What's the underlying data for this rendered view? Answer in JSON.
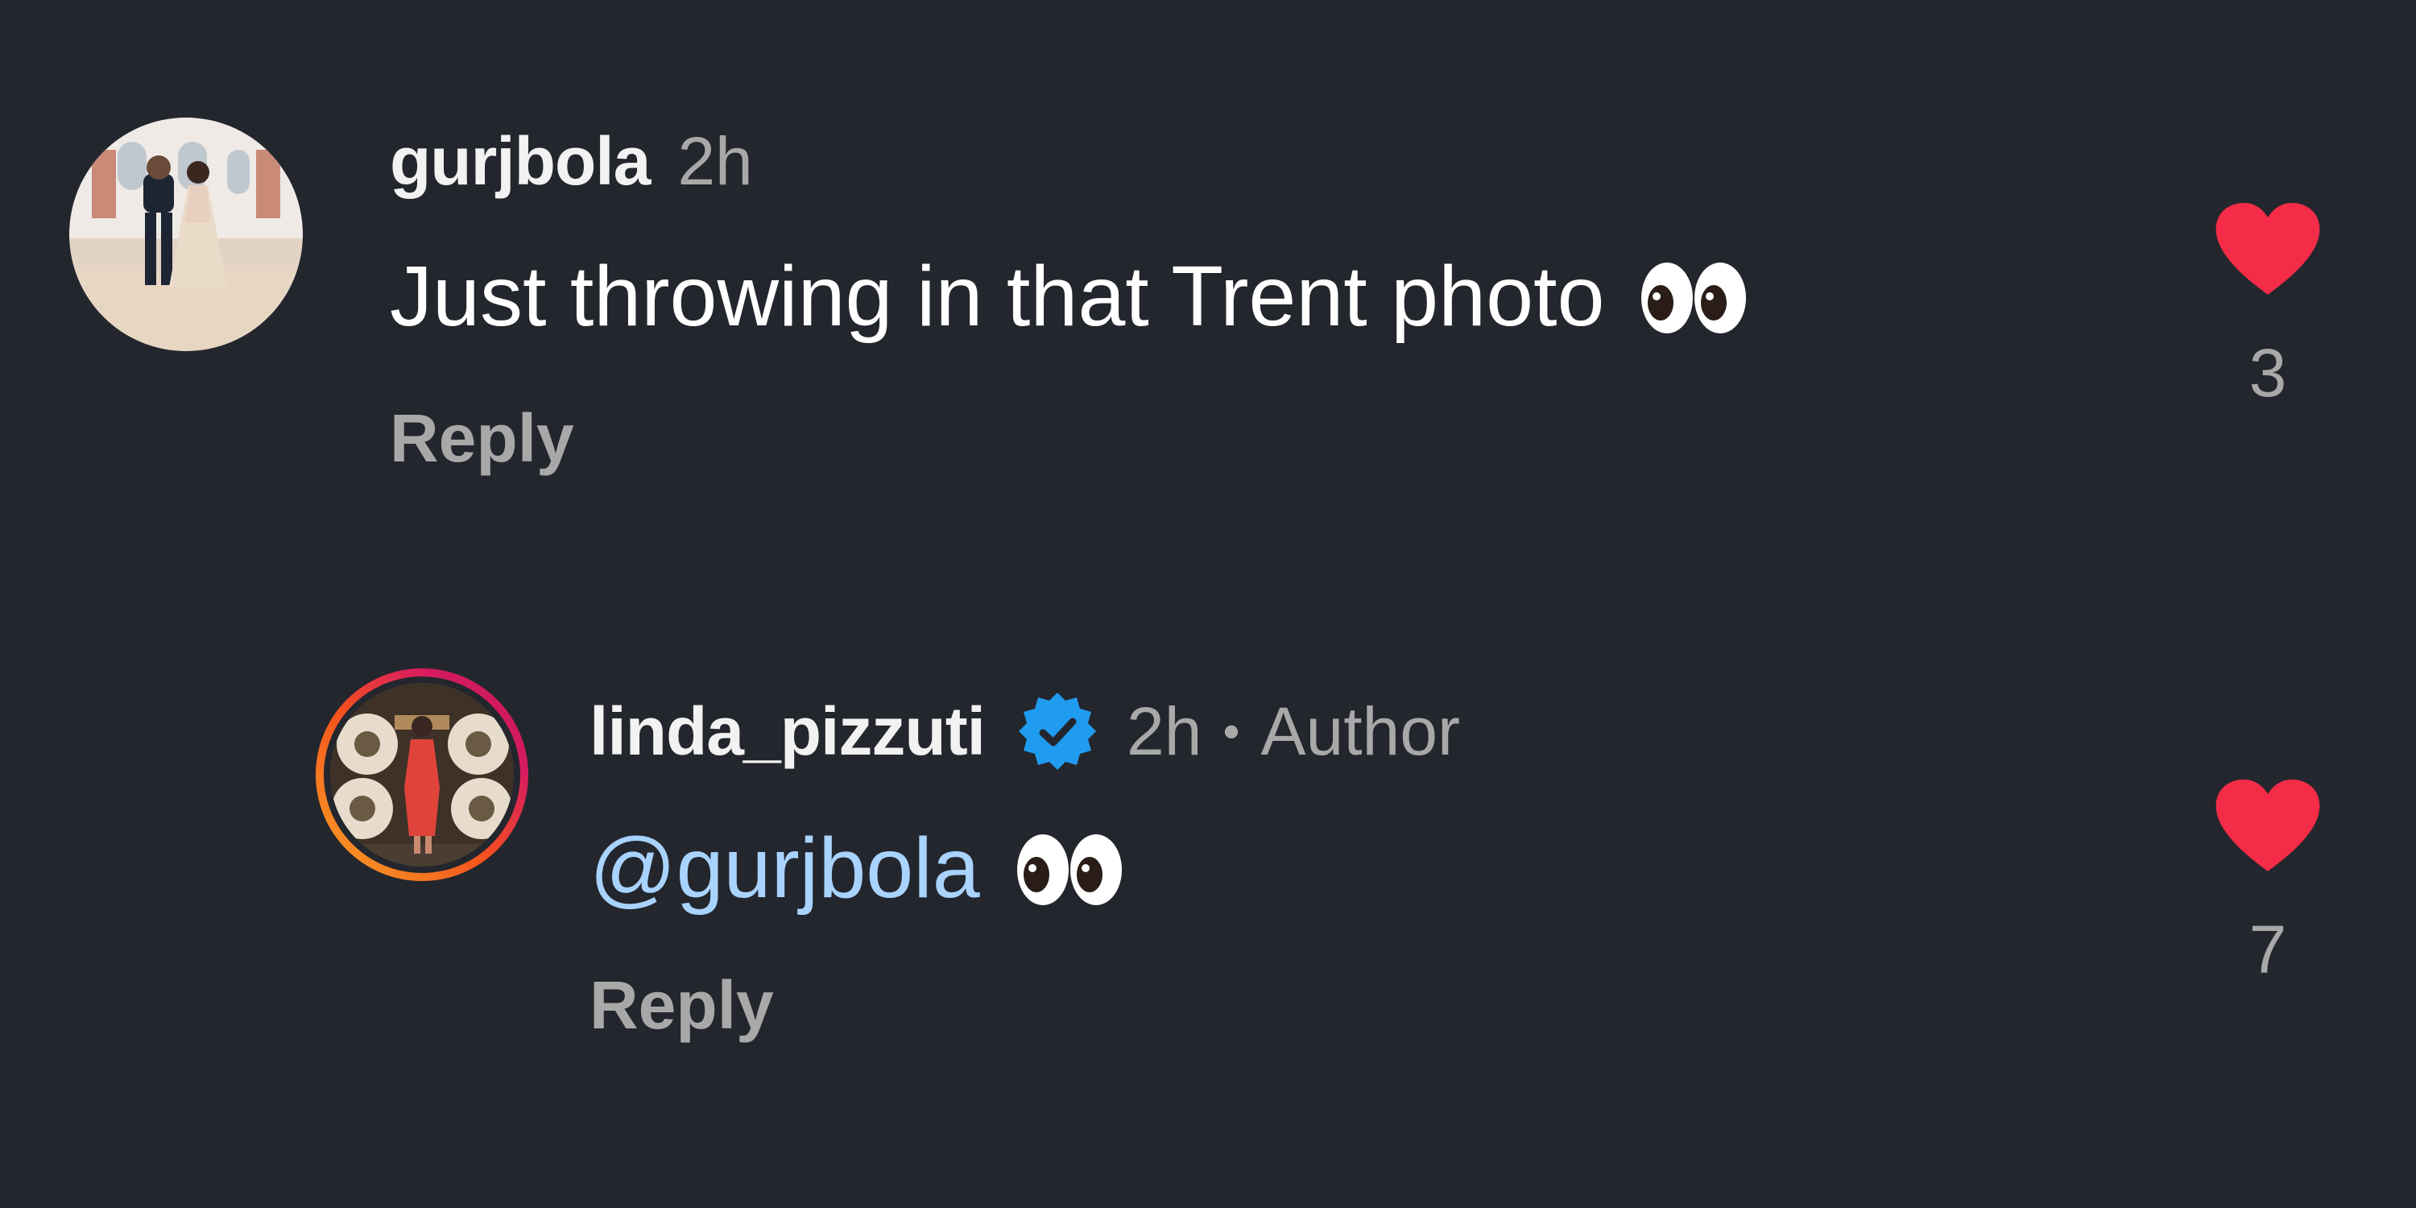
{
  "colors": {
    "background": "#24262d",
    "heart": "#f52c47",
    "mention": "#a8d3ff",
    "verified": "#1f9bf0",
    "secondary_text": "#a8a8a8"
  },
  "comments": [
    {
      "username": "gurjbola",
      "time": "2h",
      "text": "Just throwing in that Trent photo",
      "emoji": "👀",
      "reply_label": "Reply",
      "likes": "3",
      "avatar": "couple-wedding-photo"
    },
    {
      "username": "linda_pizzuti",
      "verified": true,
      "time": "2h",
      "separator": "•",
      "badge": "Author",
      "mention": "@gurjbola",
      "emoji": "👀",
      "reply_label": "Reply",
      "likes": "7",
      "avatar": "woman-red-dress-story-ring"
    }
  ]
}
